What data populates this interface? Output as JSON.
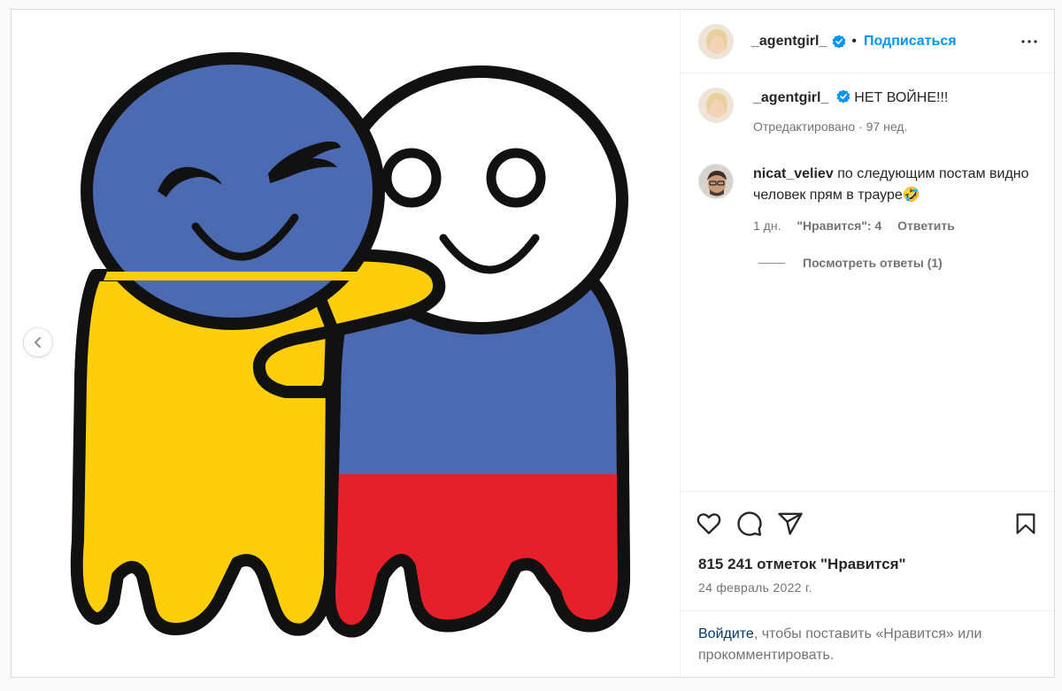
{
  "post": {
    "author": "_agentgirl_",
    "follow_label": "Подписаться",
    "dot": "•",
    "caption": {
      "text": "НЕТ ВОЙНЕ!!!",
      "meta": "Отредактировано · 97 нед."
    },
    "comment": {
      "username": "nicat_veliev",
      "text": "по следующим постам видно человек прям в трауре🤣",
      "time": "1 дн.",
      "likes": "\"Нравится\": 4",
      "reply": "Ответить"
    },
    "view_replies": "Посмотреть ответы (1)",
    "likes_count": "815 241 отметок \"Нравится\"",
    "date": "24 февраль 2022 г.",
    "login_link": "Войдите",
    "login_rest": ", чтобы поставить «Нравится» или прокомментировать."
  },
  "colors": {
    "accent_blue": "#0095f6",
    "link_dark": "#00376b",
    "flag_blue": "#4b6ab2",
    "flag_yellow": "#ffce0b",
    "flag_red": "#e5202b"
  },
  "icons": [
    "chevron-left-icon",
    "verified-badge-icon",
    "more-options-icon",
    "heart-icon",
    "comment-icon",
    "share-icon",
    "bookmark-icon"
  ]
}
